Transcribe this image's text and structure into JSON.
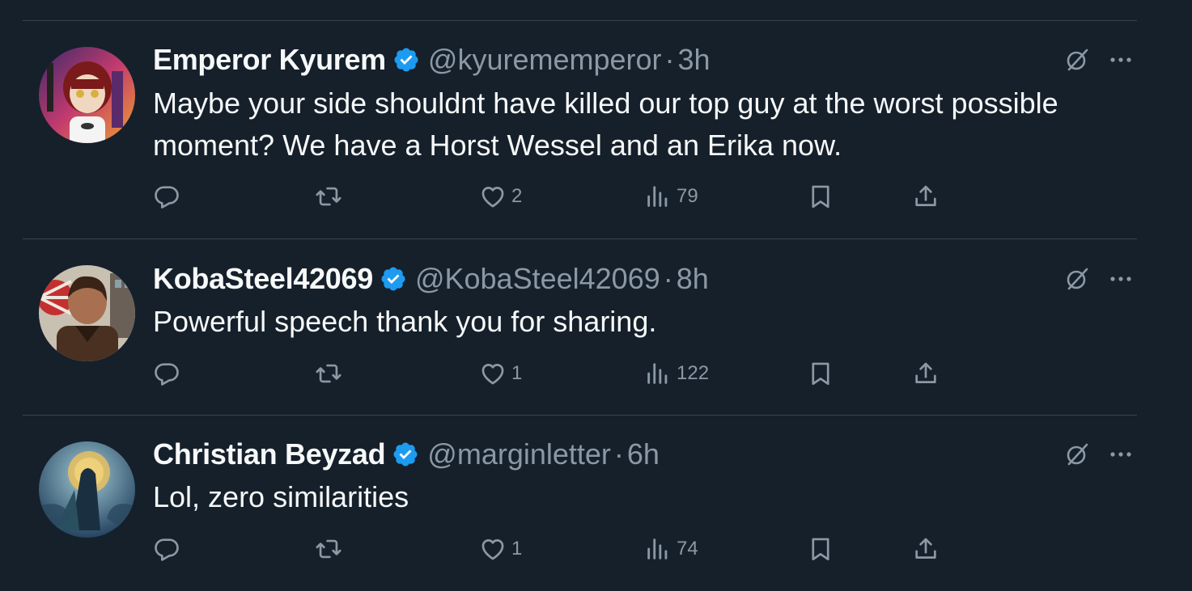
{
  "tweets": [
    {
      "display_name": "Emperor Kyurem",
      "handle": "@kyurememperor",
      "separator": "·",
      "time": "3h",
      "text": "Maybe your side shouldnt have killed our top guy at the worst possible moment? We have a Horst Wessel and an Erika now.",
      "reply_count": "",
      "retweet_count": "",
      "like_count": "2",
      "view_count": "79"
    },
    {
      "display_name": "KobaSteel42069",
      "handle": "@KobaSteel42069",
      "separator": "·",
      "time": "8h",
      "text": "Powerful speech thank you for sharing.",
      "reply_count": "",
      "retweet_count": "",
      "like_count": "1",
      "view_count": "122"
    },
    {
      "display_name": "Christian Beyzad",
      "handle": "@marginletter",
      "separator": "·",
      "time": "6h",
      "text": "Lol, zero similarities",
      "reply_count": "",
      "retweet_count": "",
      "like_count": "1",
      "view_count": "74"
    }
  ],
  "icons": {
    "verified": "verified-badge-icon",
    "grok": "grok-icon",
    "more": "more-icon",
    "reply": "reply-icon",
    "retweet": "retweet-icon",
    "like": "like-icon",
    "views": "views-icon",
    "bookmark": "bookmark-icon",
    "share": "share-icon"
  },
  "colors": {
    "background": "#15202b",
    "text": "#f7f9f9",
    "muted": "#8b98a5",
    "divider": "#38444d",
    "verified": "#1d9bf0"
  }
}
